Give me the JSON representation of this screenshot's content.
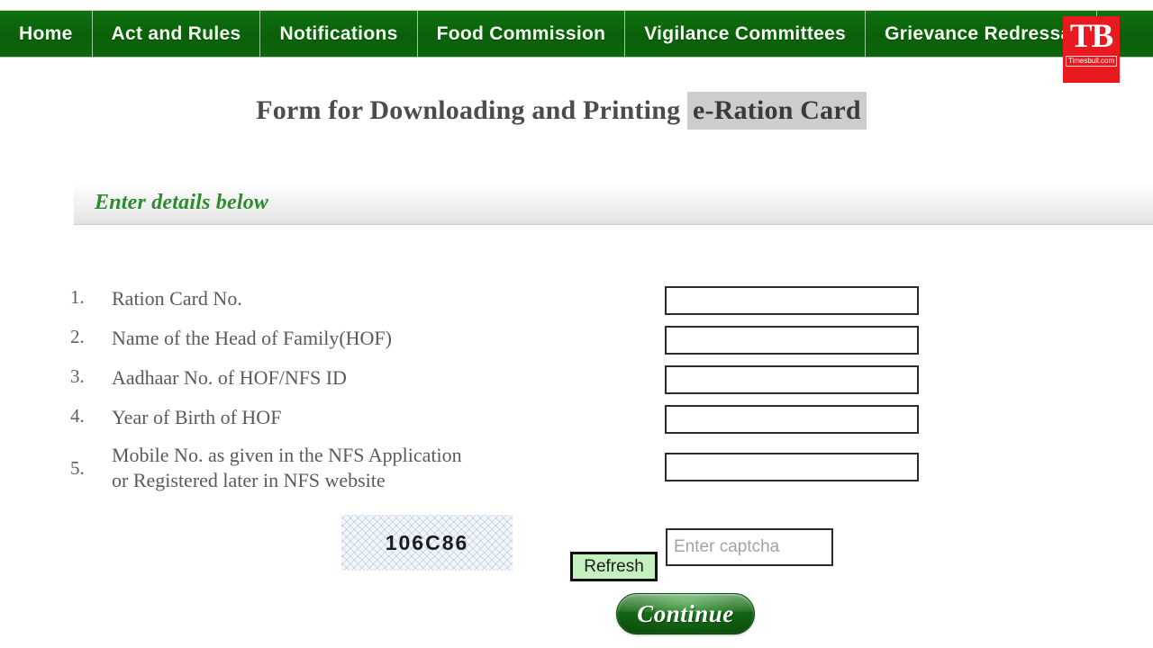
{
  "nav": {
    "items": [
      {
        "label": "Home"
      },
      {
        "label": "Act and Rules"
      },
      {
        "label": "Notifications"
      },
      {
        "label": "Food Commission"
      },
      {
        "label": "Vigilance Committees"
      },
      {
        "label": "Grievance Redressal"
      }
    ]
  },
  "watermark": {
    "initials": "TB",
    "site": "Timesbull.com"
  },
  "title": {
    "prefix": "Form for Downloading and Printing ",
    "highlight": "e-Ration Card"
  },
  "section": {
    "heading": "Enter details below"
  },
  "form": {
    "fields": [
      {
        "num": "1.",
        "label": "Ration Card No.",
        "label2": "",
        "value": "",
        "placeholder": ""
      },
      {
        "num": "2.",
        "label": "Name of the Head of Family(HOF)",
        "label2": "",
        "value": "",
        "placeholder": ""
      },
      {
        "num": "3.",
        "label": "Aadhaar No. of HOF/NFS ID",
        "label2": "",
        "value": "",
        "placeholder": ""
      },
      {
        "num": "4.",
        "label": "Year of Birth of HOF",
        "label2": "",
        "value": "",
        "placeholder": ""
      },
      {
        "num": "5.",
        "label": "Mobile No. as given in the NFS Application",
        "label2": "or Registered later in NFS website",
        "value": "",
        "placeholder": ""
      }
    ]
  },
  "captcha": {
    "code": "106C86",
    "refresh_label": "Refresh",
    "input_value": "",
    "input_placeholder": "Enter captcha"
  },
  "actions": {
    "continue_label": "Continue"
  },
  "colors": {
    "nav_green": "#0c6b0c",
    "heading_green": "#2d8a2d",
    "refresh_green": "#c5f0bf",
    "watermark_red": "#e8191f",
    "title_highlight": "#cdcdcd"
  }
}
